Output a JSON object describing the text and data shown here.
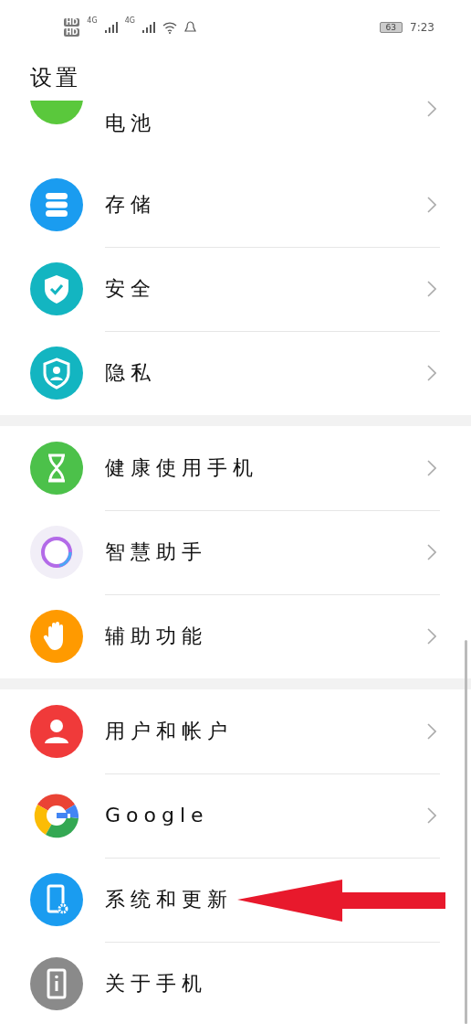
{
  "status_bar": {
    "sim_labels": [
      "HD",
      "HD"
    ],
    "network_labels": [
      "4G",
      "4G"
    ],
    "battery": "63",
    "time": "7:23"
  },
  "title": "设置",
  "groups": [
    {
      "items": [
        {
          "label": "电池",
          "chevron": true,
          "partial": true
        },
        {
          "label": "存储",
          "chevron": true,
          "partial": false
        },
        {
          "label": "安全",
          "chevron": true,
          "partial": false
        },
        {
          "label": "隐私",
          "chevron": true,
          "partial": false
        }
      ]
    },
    {
      "items": [
        {
          "label": "健康使用手机",
          "chevron": true,
          "partial": false
        },
        {
          "label": "智慧助手",
          "chevron": true,
          "partial": false
        },
        {
          "label": "辅助功能",
          "chevron": true,
          "partial": false
        }
      ]
    },
    {
      "items": [
        {
          "label": "用户和帐户",
          "chevron": true,
          "partial": false
        },
        {
          "label": "Google",
          "chevron": true,
          "partial": false
        },
        {
          "label": "系统和更新",
          "chevron": false,
          "partial": false
        },
        {
          "label": "关于手机",
          "chevron": false,
          "partial": false
        }
      ]
    }
  ]
}
